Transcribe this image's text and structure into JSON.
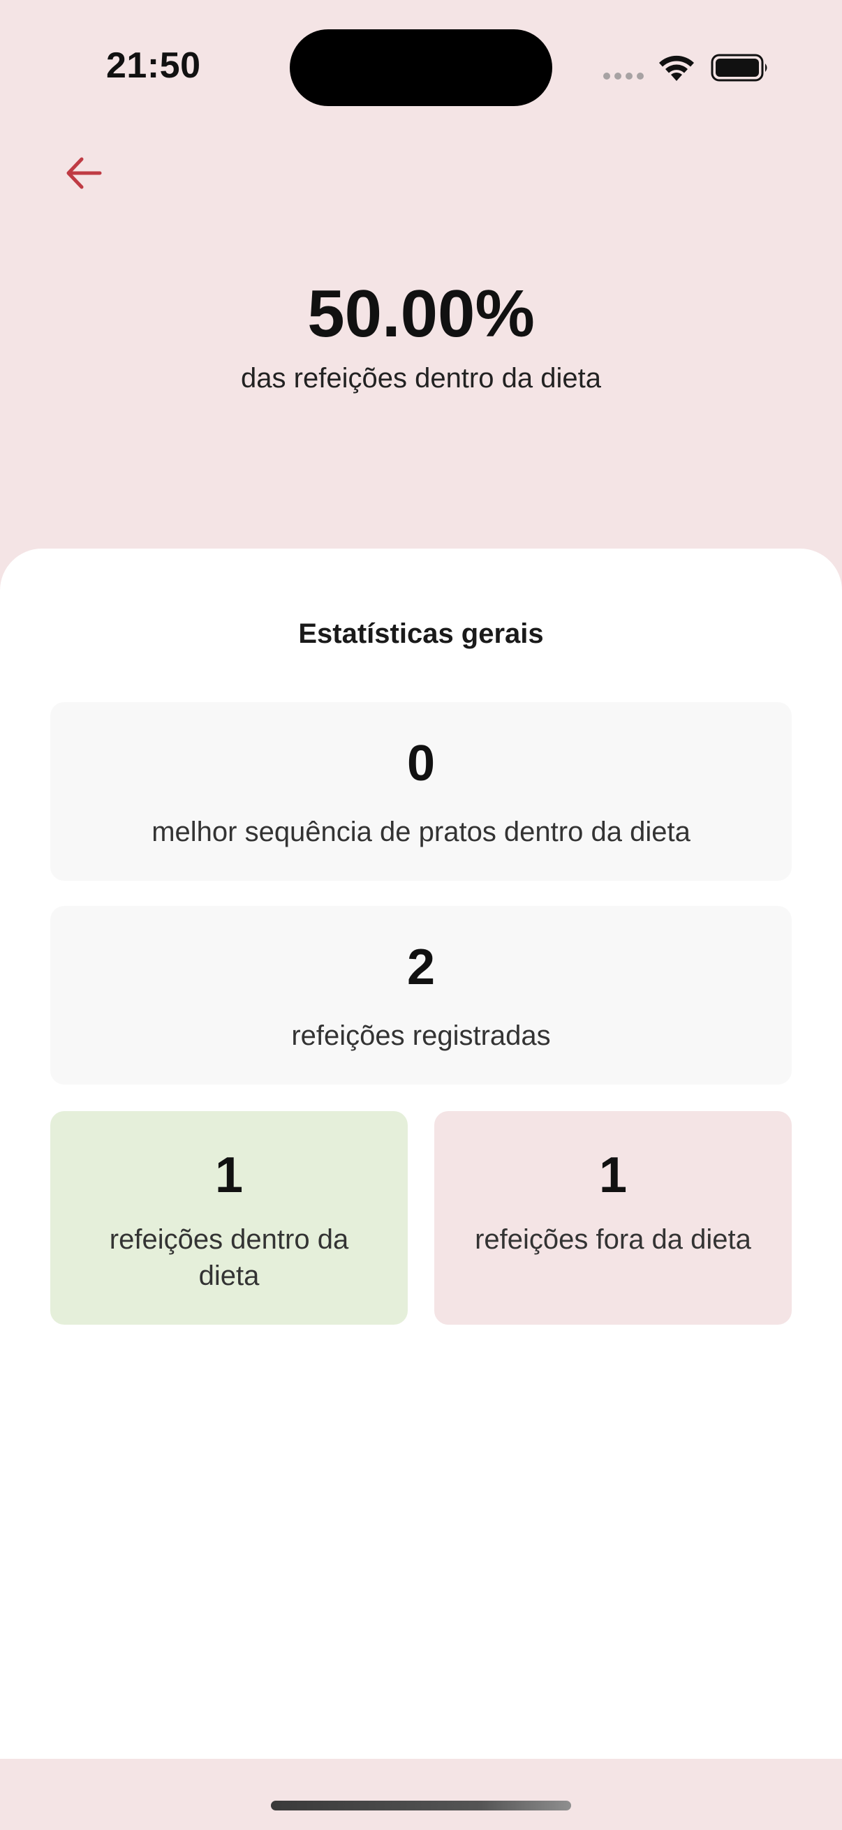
{
  "status_bar": {
    "time": "21:50"
  },
  "header": {
    "back_icon": "arrow-left-icon",
    "accent_color": "#bf3b44",
    "percentage": "50.00%",
    "caption": "das refeições dentro da dieta",
    "background": "#f4e4e5"
  },
  "stats": {
    "title": "Estatísticas gerais",
    "best_sequence": {
      "value": "0",
      "label": "melhor sequência de pratos dentro da dieta"
    },
    "registered": {
      "value": "2",
      "label": "refeições registradas"
    },
    "in_diet": {
      "value": "1",
      "label": "refeições dentro da dieta",
      "color": "#e5efda"
    },
    "out_diet": {
      "value": "1",
      "label": "refeições fora da dieta",
      "color": "#f4e4e5"
    }
  }
}
